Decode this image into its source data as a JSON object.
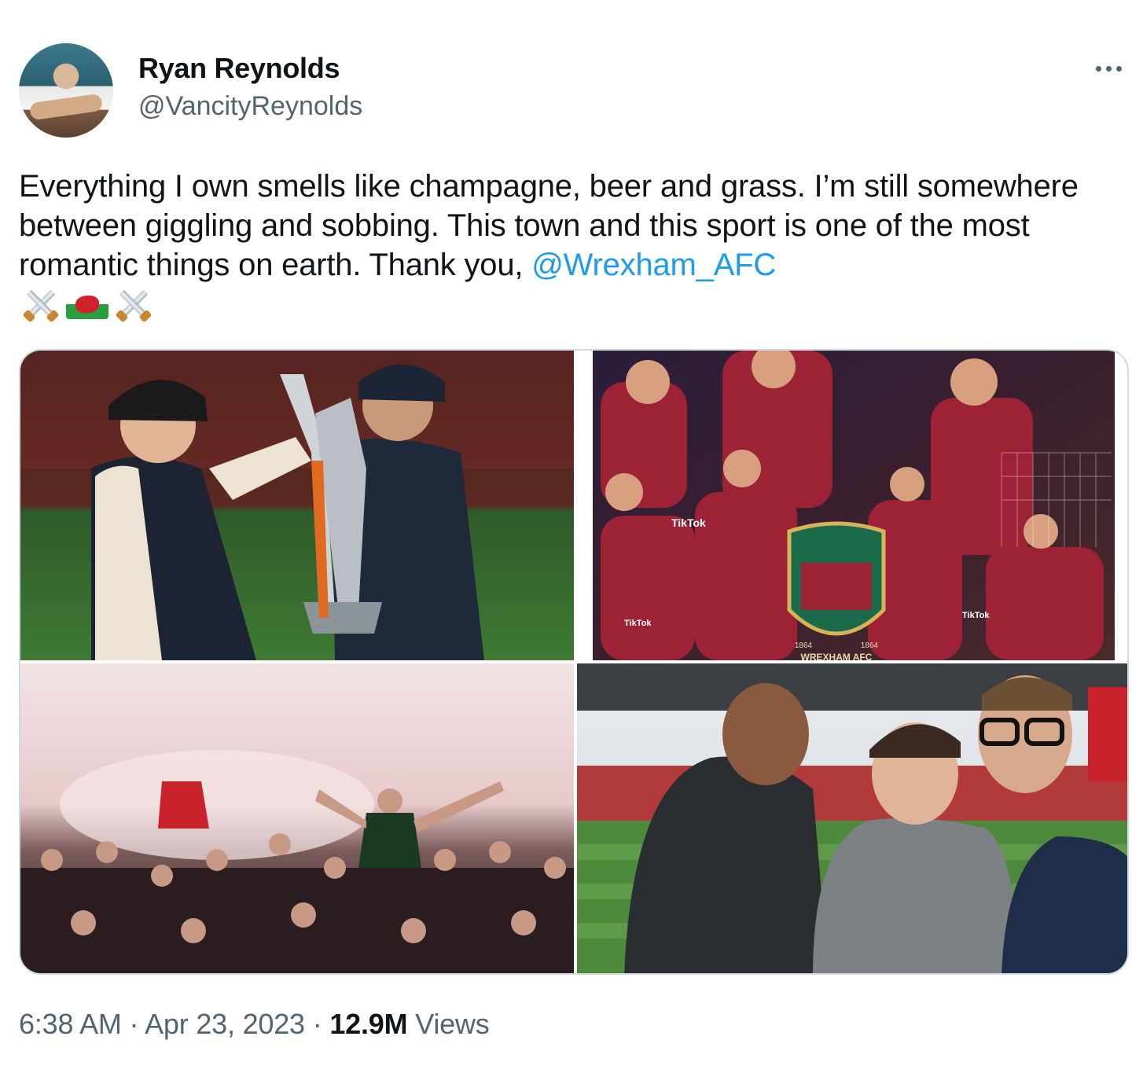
{
  "author": {
    "name": "Ryan Reynolds",
    "handle": "@VancityReynolds"
  },
  "tweet": {
    "text": "Everything I own smells like champagne, beer and grass. I’m still somewhere between giggling and sobbing. This town and this sport is one of the most romantic things on earth. Thank you, ",
    "mention": "@Wrexham_AFC",
    "emojis": [
      "crossed-swords",
      "wales-flag",
      "crossed-swords"
    ]
  },
  "media": {
    "images": [
      {
        "alt_name": "trophy-celebration-photo"
      },
      {
        "alt_name": "team-collage-photo",
        "tiktok_labels": [
          "TikTok",
          "TikTok",
          "TikTok"
        ],
        "crest_text": "WREXHAM AFC",
        "crest_years": [
          "1864",
          "1864"
        ]
      },
      {
        "alt_name": "fans-pitch-invasion-photo"
      },
      {
        "alt_name": "stadium-selfie-photo"
      }
    ]
  },
  "meta": {
    "time": "6:38 AM",
    "separator": "·",
    "date": "Apr 23, 2023",
    "views_count": "12.9M",
    "views_label": "Views"
  },
  "colors": {
    "text": "#0f1419",
    "secondary": "#536471",
    "link": "#1d9bf0",
    "border": "#cfd9de"
  }
}
